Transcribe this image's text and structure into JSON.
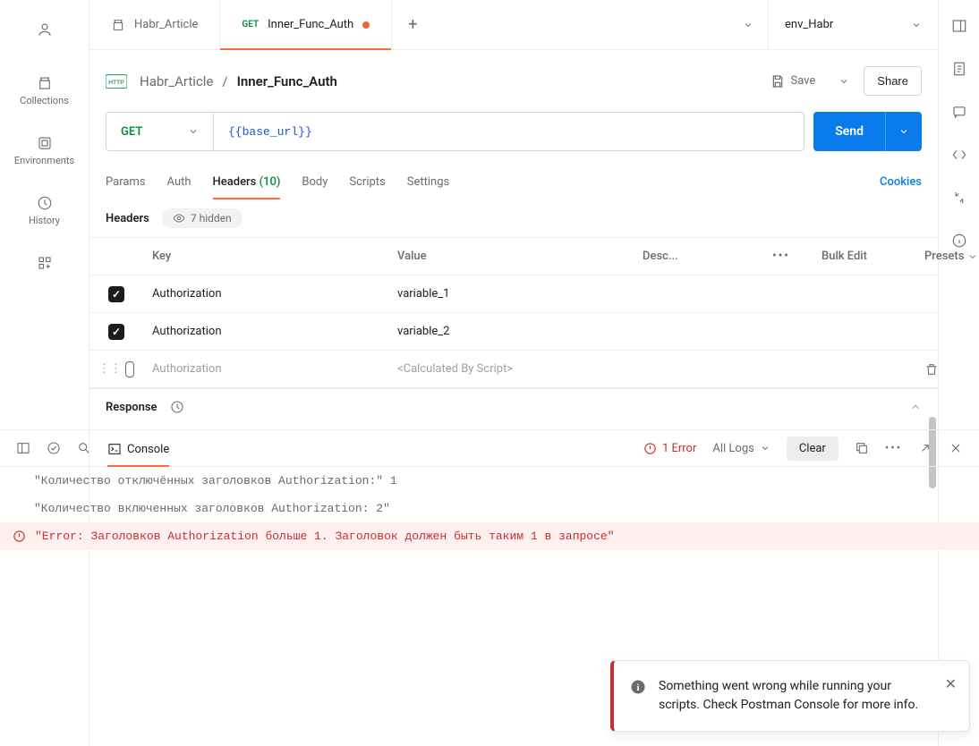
{
  "left_nav": {
    "collections": "Collections",
    "environments": "Environments",
    "history": "History"
  },
  "tabs": {
    "tab1": {
      "label": "Habr_Article"
    },
    "tab2": {
      "method": "GET",
      "label": "Inner_Func_Auth"
    }
  },
  "env_selector": "env_Habr",
  "breadcrumb": {
    "parent": "Habr_Article",
    "current": "Inner_Func_Auth"
  },
  "actions": {
    "save": "Save",
    "share": "Share"
  },
  "request": {
    "method": "GET",
    "url_text": "{{base_url}}",
    "send": "Send"
  },
  "req_tabs": {
    "params": "Params",
    "auth": "Auth",
    "headers": "Headers",
    "headers_count": "(10)",
    "body": "Body",
    "scripts": "Scripts",
    "settings": "Settings",
    "cookies": "Cookies"
  },
  "headers_section": {
    "title": "Headers",
    "hidden_text": "7 hidden",
    "cols": {
      "key": "Key",
      "value": "Value",
      "desc": "Desc...",
      "bulk": "Bulk Edit",
      "presets": "Presets"
    },
    "rows": [
      {
        "enabled": true,
        "key": "Authorization",
        "value": "variable_1"
      },
      {
        "enabled": true,
        "key": "Authorization",
        "value": "variable_2"
      }
    ],
    "draft": {
      "key": "Authorization",
      "value": "<Calculated By Script>"
    }
  },
  "response_section": {
    "title": "Response"
  },
  "console": {
    "label": "Console",
    "error_count": "1 Error",
    "all_logs": "All Logs",
    "clear": "Clear",
    "logs": [
      "\"Количество отключённых заголовков Authorization:\"  1",
      "\"Количество включенных заголовков Authorization: 2\"",
      "\"Error: Заголовков Authorization больше 1. Заголовок должен быть таким 1 в запросе\""
    ]
  },
  "toast": {
    "text": "Something went wrong while running your scripts. Check Postman Console for more info."
  }
}
